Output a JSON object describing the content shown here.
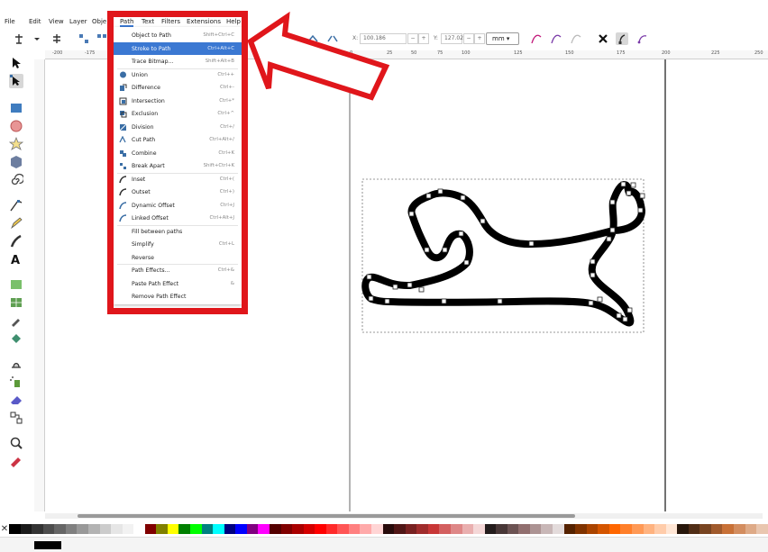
{
  "menubar": {
    "items": [
      "File",
      "Edit",
      "View",
      "Layer",
      "Obje",
      "Path",
      "Text",
      "Filters",
      "Extensions",
      "Help"
    ],
    "active": "Path"
  },
  "toolbar": {
    "x_label": "X:",
    "x_value": "100.186",
    "y_label": "Y:",
    "y_value": "127.021",
    "unit": "mm",
    "stepper_minus": "−",
    "stepper_plus": "+"
  },
  "ruler_top_ticks": [
    "-200",
    "-175",
    "-50",
    "0",
    "25",
    "50",
    "75",
    "100",
    "125",
    "150",
    "175",
    "200",
    "225",
    "250"
  ],
  "path_menu": {
    "items": [
      {
        "label": "Object to Path",
        "shortcut": "Shift+Ctrl+C",
        "icon": "none"
      },
      {
        "label": "Stroke to Path",
        "shortcut": "Ctrl+Alt+C",
        "icon": "none",
        "highlighted": true
      },
      {
        "label": "Trace Bitmap...",
        "shortcut": "Shift+Alt+B",
        "icon": "none"
      },
      {
        "label": "Union",
        "shortcut": "Ctrl++",
        "icon": "union-icon"
      },
      {
        "label": "Difference",
        "shortcut": "Ctrl+-",
        "icon": "difference-icon"
      },
      {
        "label": "Intersection",
        "shortcut": "Ctrl+*",
        "icon": "intersection-icon"
      },
      {
        "label": "Exclusion",
        "shortcut": "Ctrl+^",
        "icon": "exclusion-icon"
      },
      {
        "label": "Division",
        "shortcut": "Ctrl+/",
        "icon": "division-icon"
      },
      {
        "label": "Cut Path",
        "shortcut": "Ctrl+Alt+/",
        "icon": "cut-path-icon"
      },
      {
        "label": "Combine",
        "shortcut": "Ctrl+K",
        "icon": "combine-icon"
      },
      {
        "label": "Break Apart",
        "shortcut": "Shift+Ctrl+K",
        "icon": "break-apart-icon"
      },
      {
        "label": "Inset",
        "shortcut": "Ctrl+(",
        "icon": "inset-icon"
      },
      {
        "label": "Outset",
        "shortcut": "Ctrl+)",
        "icon": "outset-icon"
      },
      {
        "label": "Dynamic Offset",
        "shortcut": "Ctrl+J",
        "icon": "dynamic-offset-icon"
      },
      {
        "label": "Linked Offset",
        "shortcut": "Ctrl+Alt+J",
        "icon": "linked-offset-icon"
      },
      {
        "label": "Fill between paths",
        "shortcut": "",
        "icon": "none"
      },
      {
        "label": "Simplify",
        "shortcut": "Ctrl+L",
        "icon": "none"
      },
      {
        "label": "Reverse",
        "shortcut": "",
        "icon": "none"
      },
      {
        "label": "Path Effects...",
        "shortcut": "Ctrl+&",
        "icon": "none"
      },
      {
        "label": "Paste Path Effect",
        "shortcut": "&",
        "icon": "none"
      },
      {
        "label": "Remove Path Effect",
        "shortcut": "",
        "icon": "none"
      }
    ]
  },
  "colors": {
    "highlight_box": "#e0161b",
    "menu_highlight": "#3b78d2",
    "path_stroke": "#000000"
  },
  "palette": [
    "#000000",
    "#1a1a1a",
    "#333333",
    "#4d4d4d",
    "#666666",
    "#808080",
    "#999999",
    "#b3b3b3",
    "#cccccc",
    "#e6e6e6",
    "#f2f2f2",
    "#ffffff",
    "#800000",
    "#808000",
    "#ffff00",
    "#008000",
    "#00ff00",
    "#008080",
    "#00ffff",
    "#000080",
    "#0000ff",
    "#800080",
    "#ff00ff",
    "#550000",
    "#800000",
    "#aa0000",
    "#d40000",
    "#ff0000",
    "#ff2a2a",
    "#ff5555",
    "#ff8080",
    "#ffaaaa",
    "#ffd5d5",
    "#280b0b",
    "#501616",
    "#782121",
    "#a02c2c",
    "#c83737",
    "#d35f5f",
    "#de8787",
    "#e9afaf",
    "#f4d7d7",
    "#241c1c",
    "#483737",
    "#6c5353",
    "#916f6f",
    "#ac9393",
    "#c8b7b7",
    "#e3dbdb",
    "#552200",
    "#803300",
    "#aa4400",
    "#d45500",
    "#ff6600",
    "#ff7f2a",
    "#ff9955",
    "#ffb380",
    "#ffccaa",
    "#ffe6d5",
    "#28170b",
    "#502d16",
    "#784421",
    "#a05a2c",
    "#c87137",
    "#d38d5f",
    "#deaa87",
    "#e9c6af"
  ]
}
